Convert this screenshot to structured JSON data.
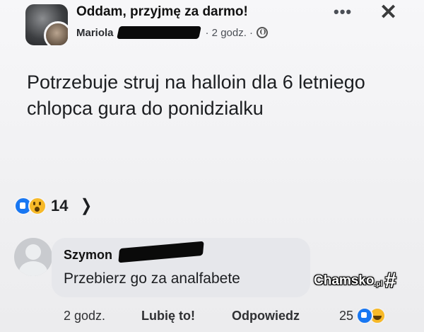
{
  "post": {
    "group_name": "Oddam, przyjmę za darmo!",
    "author": "Mariola",
    "time": "· 2 godz. ·",
    "text": "Potrzebuje struj na halloin dla 6 letniego chlopca gura do ponidzialku",
    "more_glyph": "•••",
    "close_glyph": "✕",
    "reaction_count": "14",
    "chevron_glyph": "❯"
  },
  "comment": {
    "author": "Szymon",
    "text": "Przebierz go za analfabete",
    "time": "2 godz.",
    "like_label": "Lubię to!",
    "reply_label": "Odpowiedz",
    "reaction_count": "25"
  },
  "watermark": {
    "brand": "Chamsko",
    "suffix": ".pl",
    "hash": "#"
  },
  "colors": {
    "like_blue": "#1877f2",
    "reaction_yellow": "#f7b928",
    "bubble_gray": "#e6e7eb"
  },
  "icons": [
    "group-avatar-icon",
    "globe-icon",
    "more-options-icon",
    "close-icon",
    "like-reaction-icon",
    "wow-reaction-icon",
    "haha-reaction-icon",
    "chevron-right-icon",
    "default-avatar-icon"
  ]
}
